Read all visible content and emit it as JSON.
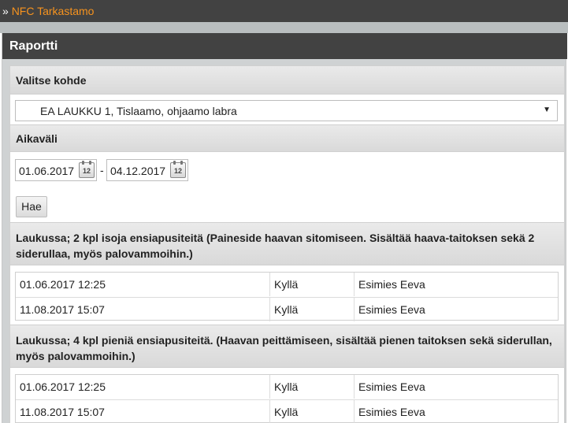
{
  "topbar": {
    "separator": "»",
    "breadcrumb": "NFC Tarkastamo"
  },
  "panel": {
    "title": "Raportti"
  },
  "target": {
    "heading": "Valitse kohde",
    "selected": "EA LAUKKU 1, Tislaamo, ohjaamo labra",
    "caret": "▼"
  },
  "range": {
    "heading": "Aikaväli",
    "from": "01.06.2017",
    "to": "04.12.2017",
    "dash": "-",
    "cal_icon_text": "12"
  },
  "search_button": "Hae",
  "items": [
    {
      "title": "Laukussa; 2 kpl isoja ensiapusiteitä (Paineside haavan sitomiseen. Sisältää haava-taitoksen sekä 2 siderullaa, myös palovammoihin.)",
      "rows": [
        {
          "time": "01.06.2017 12:25",
          "status": "Kyllä",
          "person": "Esimies Eeva"
        },
        {
          "time": "11.08.2017 15:07",
          "status": "Kyllä",
          "person": "Esimies Eeva"
        }
      ]
    },
    {
      "title": "Laukussa; 4 kpl pieniä ensiapusiteitä. (Haavan peittämiseen, sisältää pienen taitoksen sekä siderullan, myös palovammoihin.)",
      "rows": [
        {
          "time": "01.06.2017 12:25",
          "status": "Kyllä",
          "person": "Esimies Eeva"
        },
        {
          "time": "11.08.2017 15:07",
          "status": "Kyllä",
          "person": "Esimies Eeva"
        }
      ]
    }
  ],
  "colors": {
    "header_bg": "#424242",
    "link": "#f7931e",
    "band": "#b9bebf"
  }
}
